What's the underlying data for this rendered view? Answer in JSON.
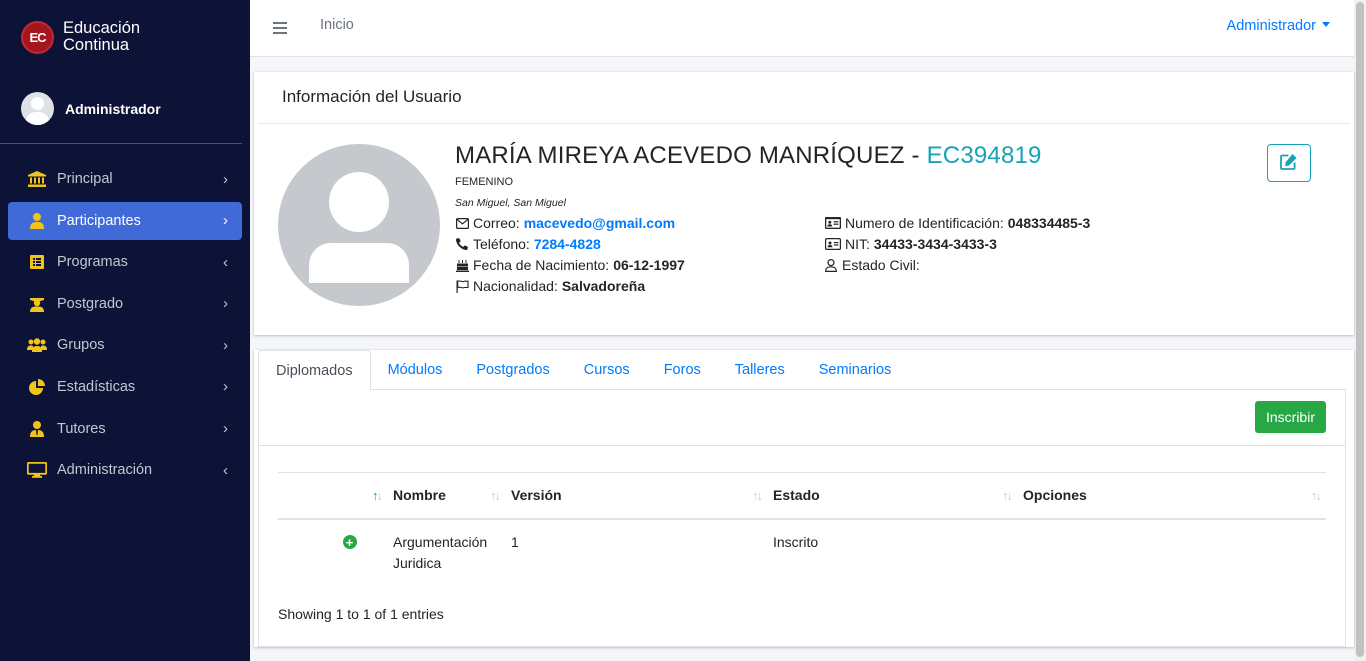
{
  "brand": {
    "logo_text": "EC",
    "line1": "Educación",
    "line2": "Continua"
  },
  "user_panel": {
    "name": "Administrador"
  },
  "sidebar": {
    "items": [
      {
        "label": "Principal",
        "icon": "bank-icon",
        "arrow": "›",
        "active": false
      },
      {
        "label": "Participantes",
        "icon": "user-icon",
        "arrow": "›",
        "active": true
      },
      {
        "label": "Programas",
        "icon": "list-icon",
        "arrow": "‹",
        "active": false
      },
      {
        "label": "Postgrado",
        "icon": "graduate-icon",
        "arrow": "›",
        "active": false
      },
      {
        "label": "Grupos",
        "icon": "users-icon",
        "arrow": "›",
        "active": false
      },
      {
        "label": "Estadísticas",
        "icon": "pie-chart-icon",
        "arrow": "›",
        "active": false
      },
      {
        "label": "Tutores",
        "icon": "tutor-icon",
        "arrow": "›",
        "active": false
      },
      {
        "label": "Administración",
        "icon": "monitor-icon",
        "arrow": "‹",
        "active": false
      }
    ]
  },
  "topbar": {
    "home_link": "Inicio",
    "user_menu": "Administrador"
  },
  "profile_card": {
    "header": "Información del Usuario",
    "name": "MARÍA MIREYA ACEVEDO MANRÍQUEZ - ",
    "code": "EC394819",
    "gender": "FEMENINO",
    "city": "San Miguel, San Miguel",
    "email_label": "Correo:",
    "email": "macevedo@gmail.com",
    "phone_label": "Teléfono:",
    "phone": "7284-4828",
    "birth_label": "Fecha de Nacimiento:",
    "birth": "06-12-1997",
    "nationality_label": "Nacionalidad:",
    "nationality": "Salvadoreña",
    "id_label": "Numero de Identificación:",
    "id_number": "048334485-3",
    "nit_label": "NIT:",
    "nit": "34433-3434-3433-3",
    "civil_label": "Estado Civil:",
    "civil": ""
  },
  "tabs": [
    {
      "label": "Diplomados",
      "active": true
    },
    {
      "label": "Módulos",
      "active": false
    },
    {
      "label": "Postgrados",
      "active": false
    },
    {
      "label": "Cursos",
      "active": false
    },
    {
      "label": "Foros",
      "active": false
    },
    {
      "label": "Talleres",
      "active": false
    },
    {
      "label": "Seminarios",
      "active": false
    }
  ],
  "diplomados": {
    "button": "Inscribir",
    "columns": [
      "",
      "Nombre",
      "Versión",
      "Estado",
      "Opciones"
    ],
    "rows": [
      {
        "nombre": "Argumentación Juridica",
        "version": "1",
        "estado": "Inscrito",
        "opciones": ""
      }
    ],
    "footer": "Showing 1 to 1 of 1 entries"
  }
}
